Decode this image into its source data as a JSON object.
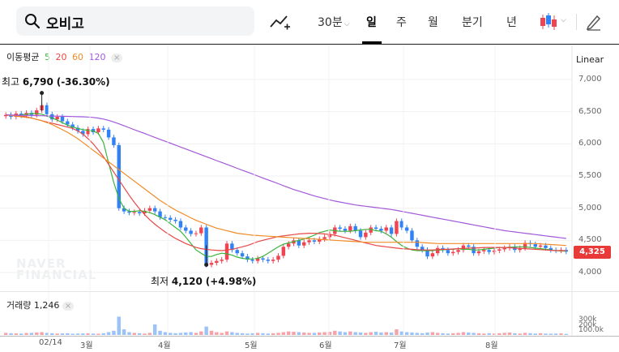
{
  "search": {
    "query": "오비고"
  },
  "tabs": [
    {
      "label": "30분",
      "active": false,
      "has_caret": true
    },
    {
      "label": "일",
      "active": true
    },
    {
      "label": "주",
      "active": false
    },
    {
      "label": "월",
      "active": false
    },
    {
      "label": "분기",
      "active": false
    },
    {
      "label": "년",
      "active": false
    }
  ],
  "toolbar": {
    "chart_type_icon": "line-chart-plus-icon",
    "candle_icon": "candlestick-icon",
    "edit_icon": "pencil-icon"
  },
  "ma_legend": {
    "title": "이동평균",
    "p5": "5",
    "p20": "20",
    "p60": "60",
    "p120": "120",
    "close": "×"
  },
  "scale_mode": "Linear",
  "y_ticks": [
    "7,000",
    "6,500",
    "6,000",
    "5,500",
    "5,000",
    "4,500",
    "4,000"
  ],
  "current_price": "4,325",
  "high": {
    "label": "최고",
    "value": "6,790",
    "change": "(-36.30%)"
  },
  "low": {
    "label": "최저",
    "value": "4,120",
    "change": "(+4.98%)"
  },
  "watermark": [
    "NAVER",
    "FINANCIAL"
  ],
  "volume": {
    "label": "거래량",
    "value": "1,246",
    "close": "×",
    "ticks": [
      "300k",
      "200k",
      "100.0k"
    ]
  },
  "x_ticks": [
    "02/14",
    "3월",
    "4월",
    "5월",
    "6월",
    "7월",
    "8월"
  ],
  "colors": {
    "up": "#f04452",
    "down": "#3182f6",
    "ma5": "#3bb33b",
    "ma20": "#e84747",
    "ma60": "#f08c28",
    "ma120": "#a259d9"
  },
  "chart_data": {
    "type": "candlestick",
    "ylim": [
      3900,
      7100
    ],
    "closes": [
      6450,
      6420,
      6470,
      6440,
      6480,
      6450,
      6520,
      6600,
      6460,
      6380,
      6420,
      6350,
      6300,
      6250,
      6200,
      6150,
      6230,
      6180,
      6240,
      6220,
      6100,
      5980,
      5000,
      4950,
      4930,
      4940,
      4920,
      4960,
      5000,
      4950,
      4860,
      4850,
      4820,
      4800,
      4700,
      4650,
      4600,
      4610,
      4700,
      4120,
      4150,
      4180,
      4200,
      4450,
      4350,
      4300,
      4250,
      4200,
      4180,
      4220,
      4200,
      4180,
      4200,
      4260,
      4400,
      4450,
      4500,
      4420,
      4470,
      4500,
      4480,
      4520,
      4550,
      4600,
      4700,
      4680,
      4650,
      4720,
      4650,
      4550,
      4620,
      4700,
      4680,
      4650,
      4700,
      4600,
      4800,
      4700,
      4650,
      4500,
      4400,
      4350,
      4250,
      4300,
      4380,
      4350,
      4300,
      4320,
      4350,
      4420,
      4400,
      4300,
      4330,
      4350,
      4320,
      4340,
      4360,
      4380,
      4400,
      4350,
      4380,
      4460,
      4440,
      4400,
      4420,
      4380,
      4350,
      4340,
      4350,
      4325
    ],
    "ma": [
      {
        "period": 5,
        "values": [
          6450,
          6440,
          6440,
          6450,
          6460,
          6470,
          6470,
          6460,
          6430,
          6400,
          6370,
          6330,
          6290,
          6260,
          6240,
          6220,
          6210,
          6200,
          6160,
          6020,
          5700,
          5400,
          5150,
          5000,
          4950,
          4950,
          4960,
          4950,
          4930,
          4900,
          4860,
          4820,
          4760,
          4700,
          4640,
          4550,
          4450,
          4350,
          4300,
          4250,
          4250,
          4280,
          4300,
          4290,
          4270,
          4240,
          4220,
          4210,
          4210,
          4220,
          4250,
          4300,
          4350,
          4400,
          4440,
          4460,
          4480,
          4500,
          4520,
          4550,
          4580,
          4620,
          4640,
          4660,
          4650,
          4640,
          4640,
          4640,
          4650,
          4660,
          4670,
          4670,
          4650,
          4640,
          4600,
          4550,
          4480,
          4420,
          4380,
          4350,
          4340,
          4340,
          4340,
          4340,
          4350,
          4350,
          4360,
          4360,
          4370,
          4360,
          4360,
          4350,
          4350,
          4360,
          4370,
          4380,
          4390,
          4390,
          4390,
          4400,
          4400,
          4400,
          4390,
          4380,
          4370,
          4360,
          4350,
          4340,
          4335,
          4330
        ]
      },
      {
        "period": 20,
        "values": [
          6450,
          6445,
          6440,
          6430,
          6420,
          6400,
          6380,
          6360,
          6340,
          6320,
          6300,
          6280,
          6260,
          6240,
          6200,
          6150,
          6080,
          6000,
          5900,
          5800,
          5680,
          5560,
          5440,
          5320,
          5200,
          5090,
          4990,
          4900,
          4820,
          4750,
          4690,
          4630,
          4580,
          4530,
          4490,
          4450,
          4420,
          4390,
          4370,
          4360,
          4350,
          4345,
          4340,
          4350,
          4360,
          4380,
          4400,
          4420,
          4450,
          4480,
          4500,
          4520,
          4540,
          4560,
          4570,
          4580,
          4590,
          4600,
          4605,
          4610,
          4610,
          4605,
          4600,
          4590,
          4580,
          4560,
          4540,
          4520,
          4500,
          4480,
          4460,
          4440,
          4420,
          4410,
          4400,
          4390,
          4380,
          4370,
          4365,
          4360,
          4355,
          4350,
          4350,
          4350,
          4355,
          4360,
          4360,
          4365,
          4370,
          4375,
          4380,
          4380,
          4385,
          4390,
          4390,
          4390,
          4390,
          4390,
          4385,
          4380,
          4375,
          4370,
          4365,
          4360,
          4355,
          4350,
          4345,
          4340,
          4340,
          4340
        ]
      },
      {
        "period": 60,
        "values": [
          6450,
          6440,
          6430,
          6420,
          6410,
          6400,
          6380,
          6360,
          6330,
          6300,
          6260,
          6220,
          6180,
          6130,
          6080,
          6020,
          5960,
          5900,
          5840,
          5780,
          5720,
          5660,
          5600,
          5540,
          5480,
          5420,
          5360,
          5300,
          5240,
          5180,
          5120,
          5070,
          5020,
          4970,
          4930,
          4890,
          4850,
          4810,
          4780,
          4750,
          4720,
          4690,
          4670,
          4650,
          4630,
          4610,
          4600,
          4590,
          4580,
          4575,
          4570,
          4565,
          4560,
          4555,
          4550,
          4545,
          4540,
          4535,
          4530,
          4525,
          4520,
          4515,
          4510,
          4505,
          4500,
          4495,
          4490,
          4485,
          4480,
          4475,
          4470,
          4470,
          4470,
          4470,
          4470,
          4470,
          4470,
          4470,
          4470,
          4470,
          4470,
          4465,
          4460,
          4455,
          4450,
          4450,
          4450,
          4450,
          4450,
          4450,
          4450,
          4450,
          4450,
          4450,
          4450,
          4450,
          4450,
          4450,
          4450,
          4450,
          4450,
          4450,
          4450,
          4450,
          4445,
          4440,
          4435,
          4430,
          4425,
          4420
        ]
      },
      {
        "period": 120,
        "values": [
          6450,
          6448,
          6446,
          6444,
          6442,
          6440,
          6438,
          6436,
          6434,
          6432,
          6430,
          6428,
          6426,
          6424,
          6422,
          6420,
          6416,
          6410,
          6400,
          6385,
          6365,
          6340,
          6310,
          6280,
          6250,
          6220,
          6190,
          6160,
          6130,
          6100,
          6070,
          6040,
          6010,
          5980,
          5950,
          5920,
          5890,
          5860,
          5830,
          5800,
          5770,
          5740,
          5710,
          5680,
          5650,
          5620,
          5590,
          5560,
          5530,
          5500,
          5470,
          5440,
          5410,
          5380,
          5350,
          5320,
          5290,
          5265,
          5240,
          5215,
          5190,
          5170,
          5150,
          5130,
          5110,
          5095,
          5080,
          5065,
          5050,
          5040,
          5030,
          5020,
          5010,
          5000,
          4990,
          4980,
          4965,
          4950,
          4935,
          4920,
          4905,
          4890,
          4875,
          4860,
          4845,
          4830,
          4815,
          4800,
          4785,
          4770,
          4755,
          4740,
          4725,
          4710,
          4695,
          4680,
          4665,
          4650,
          4640,
          4630,
          4620,
          4610,
          4600,
          4590,
          4580,
          4570,
          4560,
          4550,
          4540,
          4530
        ]
      }
    ],
    "high_point": {
      "index": 7,
      "value": 6790
    },
    "low_point": {
      "index": 39,
      "value": 4120
    },
    "volume_values": [
      30,
      25,
      22,
      20,
      28,
      30,
      35,
      40,
      30,
      25,
      20,
      22,
      25,
      18,
      20,
      22,
      24,
      20,
      18,
      25,
      40,
      60,
      260,
      80,
      40,
      30,
      25,
      20,
      30,
      150,
      60,
      40,
      30,
      25,
      30,
      35,
      40,
      30,
      50,
      120,
      60,
      40,
      30,
      50,
      40,
      30,
      25,
      20,
      25,
      30,
      25,
      20,
      25,
      30,
      40,
      50,
      45,
      40,
      35,
      30,
      30,
      35,
      40,
      45,
      60,
      50,
      40,
      50,
      40,
      35,
      30,
      40,
      45,
      35,
      40,
      35,
      80,
      50,
      40,
      35,
      30,
      25,
      35,
      40,
      30,
      25,
      20,
      25,
      30,
      40,
      35,
      30,
      25,
      20,
      25,
      20,
      25,
      30,
      35,
      25,
      20,
      30,
      25,
      20,
      25,
      20,
      18,
      20,
      22,
      15
    ]
  }
}
